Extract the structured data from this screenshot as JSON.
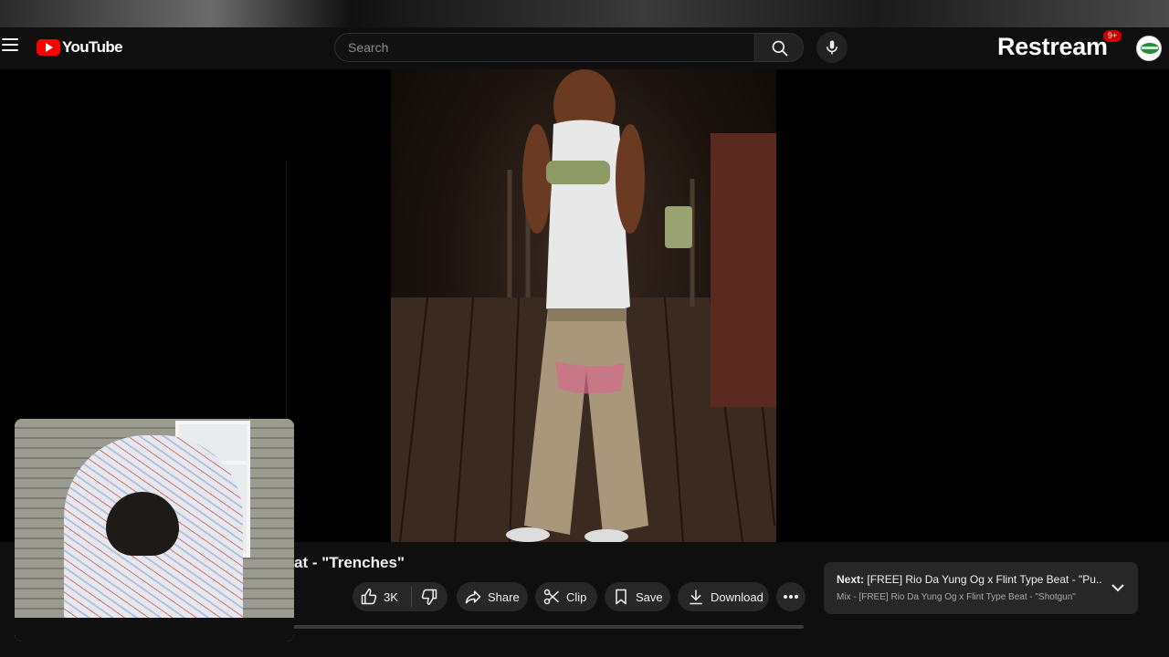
{
  "header": {
    "menu_icon": "hamburger-menu-icon",
    "logo_text": "YouTube",
    "search": {
      "placeholder": "Search",
      "value": ""
    },
    "search_icon": "search-icon",
    "mic_icon": "mic-icon",
    "overlay_brand": "Restream",
    "notifications_count": "9+",
    "avatar_icon": "avatar-icon"
  },
  "video": {
    "title_visible": "at - \"Trenches\"",
    "actions": {
      "like_count": "3K",
      "like_icon": "thumbs-up-icon",
      "dislike_icon": "thumbs-down-icon",
      "share_label": "Share",
      "clip_label": "Clip",
      "save_label": "Save",
      "download_label": "Download",
      "more_icon": "more-horizontal-icon"
    }
  },
  "next": {
    "label": "Next:",
    "title": "[FREE] Rio Da Yung Og x Flint Type Beat - \"Pu...",
    "subtitle": "Mix - [FREE] Rio Da Yung Og x Flint Type Beat - \"Shotgun\"",
    "chevron_icon": "chevron-down-icon"
  },
  "colors": {
    "background": "#0f0f0f",
    "brand_red": "#ff0000",
    "button_bg": "#272727",
    "text_primary": "#f1f1f1",
    "text_secondary": "#aaaaaa"
  }
}
